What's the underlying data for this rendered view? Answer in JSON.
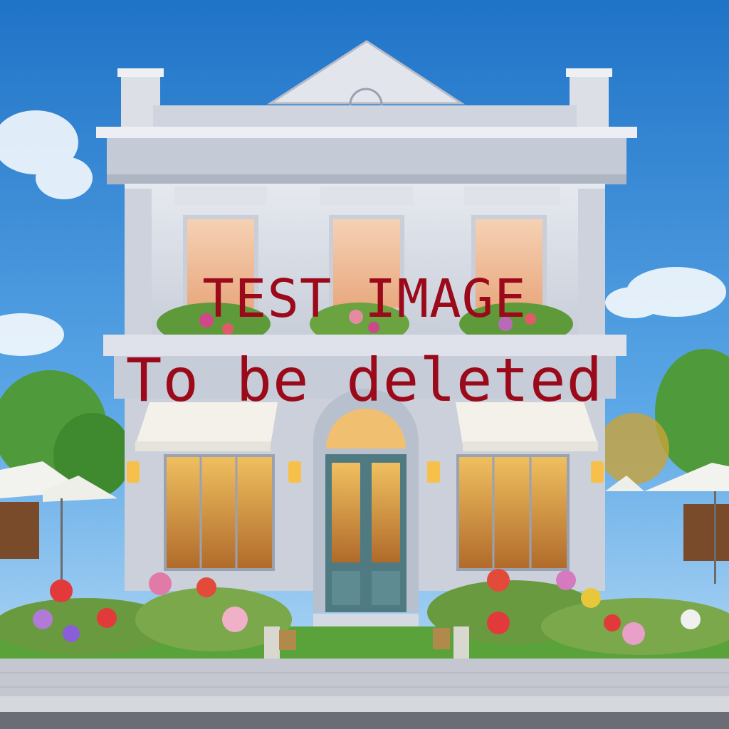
{
  "overlay": {
    "line1": "TEST IMAGE",
    "line2": "To be deleted",
    "color": "#9b0a1a"
  },
  "scene": {
    "subject": "two-storey storefront building",
    "sky_color": "#3f8fd6",
    "facade_color": "#d9dde6",
    "door_color": "#4f7a82",
    "awning_color": "#f3f1ea"
  }
}
